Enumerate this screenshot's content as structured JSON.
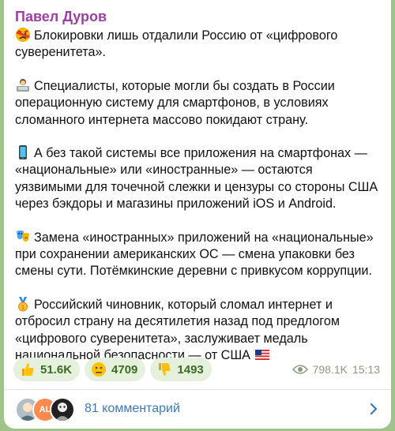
{
  "post": {
    "author": "Павел Дуров",
    "paragraphs": [
      {
        "icon": "angry-face-icon",
        "text": "Блокировки лишь отдалили Россию от «цифрового суверенитета»."
      },
      {
        "icon": "technologist-icon",
        "text": "Специалисты, которые могли бы создать в России операционную систему для смартфонов, в условиях сломанного интернета массово покидают страну."
      },
      {
        "icon": "mobile-phone-icon",
        "text": "А без такой системы все приложения на смартфонах — «национальные» или «иностранные» — остаются уязвимыми для точечной слежки и цензуры со стороны США через бэкдоры и магазины приложений iOS и Android."
      },
      {
        "icon": "theater-masks-icon",
        "text": "Замена «иностранных» приложений на «национальные» при сохранении американских ОС — смена упаковки без смены сути. Потёмкинские деревни с привкусом коррупции."
      },
      {
        "icon": "medal-icon",
        "text": "Российский чиновник, который сломал интернет и отбросил страну на десятилетия назад под предлогом «цифрового суверенитета», заслуживает медаль национальной безопасности — от США"
      }
    ],
    "flag_icon": "us-flag-icon"
  },
  "reactions": [
    {
      "icon": "thumbs-up-icon",
      "count": "51.6K"
    },
    {
      "icon": "neutral-face-icon",
      "count": "4709"
    },
    {
      "icon": "thumbs-down-icon",
      "count": "1493"
    }
  ],
  "meta": {
    "views": "798.1K",
    "time": "15:13",
    "icon": "eye-icon"
  },
  "comments": {
    "label": "81 комментарий",
    "avatar_initials": "AL"
  },
  "colors": {
    "author": "#9c3fa5",
    "link": "#3a78b7",
    "reaction_bg": "#e6f1dd",
    "reaction_text": "#3a6d1f",
    "background": "#9fc38a"
  }
}
